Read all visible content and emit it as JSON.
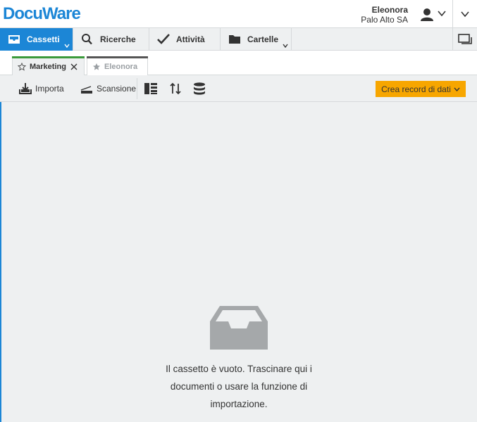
{
  "header": {
    "logo": "DocuWare",
    "user_name": "Eleonora",
    "user_company": "Palo Alto SA"
  },
  "nav": {
    "items": [
      {
        "label": "Cassetti",
        "icon": "tray-icon",
        "active": true
      },
      {
        "label": "Ricerche",
        "icon": "search-icon",
        "active": false
      },
      {
        "label": "Attività",
        "icon": "checkmark-icon",
        "active": false
      },
      {
        "label": "Cartelle",
        "icon": "folder-icon",
        "active": false
      }
    ]
  },
  "tabs": [
    {
      "label": "Marketing",
      "active": true,
      "bar_color": "#3a9a3a"
    },
    {
      "label": "Eleonora",
      "active": false,
      "bar_color": "#555555"
    }
  ],
  "toolbar": {
    "import_label": "Importa",
    "scan_label": "Scansione",
    "create_label": "Crea record di dati",
    "accent_color": "#f7a600"
  },
  "content": {
    "empty_message": "Il cassetto è vuoto. Trascinare qui i documenti o usare la funzione di importazione."
  },
  "colors": {
    "brand": "#1c86d6",
    "background": "#eef0f1"
  }
}
